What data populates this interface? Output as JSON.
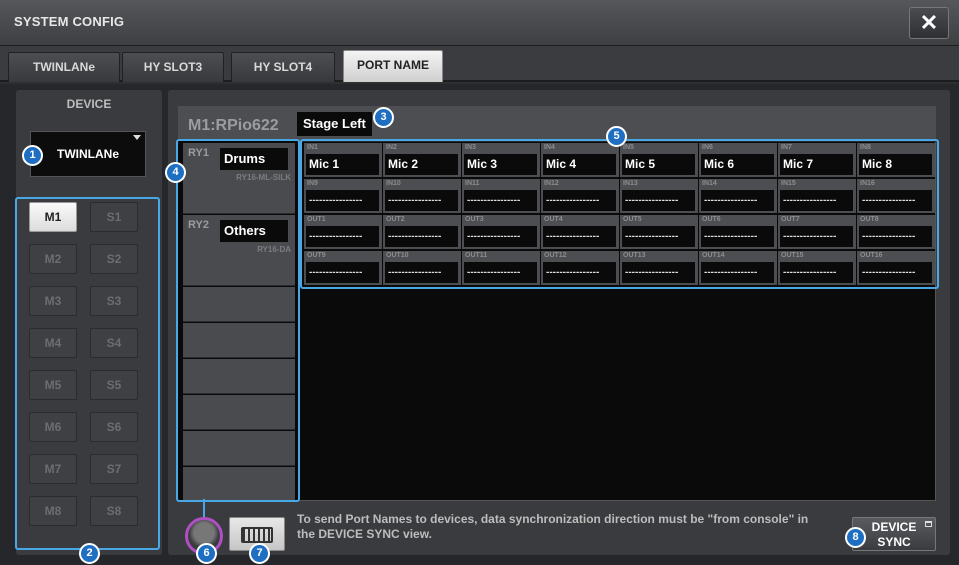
{
  "window": {
    "title": "SYSTEM CONFIG",
    "close_label": "✕"
  },
  "tabs": [
    "TWINLANe",
    "HY SLOT3",
    "HY SLOT4",
    "PORT NAME"
  ],
  "active_tab": "PORT NAME",
  "device": {
    "label": "DEVICE",
    "selected": "TWINLANe"
  },
  "slots": {
    "mains": [
      "M1",
      "M2",
      "M3",
      "M4",
      "M5",
      "M6",
      "M7",
      "M8"
    ],
    "subs": [
      "S1",
      "S2",
      "S3",
      "S4",
      "S5",
      "S6",
      "S7",
      "S8"
    ],
    "active": "M1"
  },
  "rack": {
    "name": "M1:RPio622",
    "port_name": "Stage Left"
  },
  "devices": [
    {
      "id": "RY1",
      "name": "Drums",
      "model": "RY16-ML-SILK"
    },
    {
      "id": "RY2",
      "name": "Others",
      "model": "RY16-DA"
    }
  ],
  "ports": [
    [
      {
        "label": "IN1",
        "value": "Mic 1"
      },
      {
        "label": "IN2",
        "value": "Mic 2"
      },
      {
        "label": "IN3",
        "value": "Mic 3"
      },
      {
        "label": "IN4",
        "value": "Mic 4"
      },
      {
        "label": "IN5",
        "value": "Mic 5"
      },
      {
        "label": "IN6",
        "value": "Mic 6"
      },
      {
        "label": "IN7",
        "value": "Mic 7"
      },
      {
        "label": "IN8",
        "value": "Mic 8"
      }
    ],
    [
      {
        "label": "IN9",
        "value": "----------------"
      },
      {
        "label": "IN10",
        "value": "----------------"
      },
      {
        "label": "IN11",
        "value": "----------------"
      },
      {
        "label": "IN12",
        "value": "----------------"
      },
      {
        "label": "IN13",
        "value": "----------------"
      },
      {
        "label": "IN14",
        "value": "----------------"
      },
      {
        "label": "IN15",
        "value": "----------------"
      },
      {
        "label": "IN16",
        "value": "----------------"
      }
    ],
    [
      {
        "label": "OUT1",
        "value": "----------------"
      },
      {
        "label": "OUT2",
        "value": "----------------"
      },
      {
        "label": "OUT3",
        "value": "----------------"
      },
      {
        "label": "OUT4",
        "value": "----------------"
      },
      {
        "label": "OUT5",
        "value": "----------------"
      },
      {
        "label": "OUT6",
        "value": "----------------"
      },
      {
        "label": "OUT7",
        "value": "----------------"
      },
      {
        "label": "OUT8",
        "value": "----------------"
      }
    ],
    [
      {
        "label": "OUT9",
        "value": "----------------"
      },
      {
        "label": "OUT10",
        "value": "----------------"
      },
      {
        "label": "OUT11",
        "value": "----------------"
      },
      {
        "label": "OUT12",
        "value": "----------------"
      },
      {
        "label": "OUT13",
        "value": "----------------"
      },
      {
        "label": "OUT14",
        "value": "----------------"
      },
      {
        "label": "OUT15",
        "value": "----------------"
      },
      {
        "label": "OUT16",
        "value": "----------------"
      }
    ]
  ],
  "info_text": "To send Port Names to devices, data synchronization direction must be \"from console\" in the DEVICE SYNC view.",
  "sync_button": {
    "line1": "DEVICE",
    "line2": "SYNC"
  },
  "badges": [
    "1",
    "2",
    "3",
    "4",
    "5",
    "6",
    "7",
    "8"
  ],
  "colors": {
    "highlight": "#4aa7e6",
    "badge": "#1e6fc2",
    "knob_ring": "#b04fc4"
  }
}
